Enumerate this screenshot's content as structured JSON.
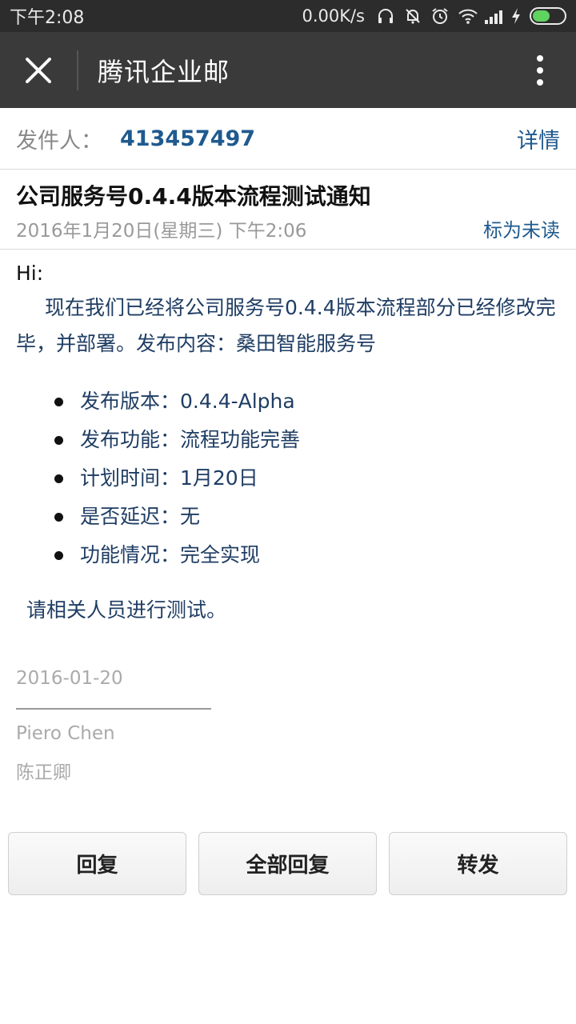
{
  "status": {
    "time": "下午2:08",
    "speed": "0.00K/s",
    "battery_level": 0.55
  },
  "appbar": {
    "title": "腾讯企业邮",
    "close_icon": "close-icon",
    "more_icon": "more-vertical-icon"
  },
  "sender": {
    "label": "发件人：",
    "address": "413457497",
    "details": "详情"
  },
  "mail": {
    "subject": "公司服务号0.4.4版本流程测试通知",
    "date": "2016年1月20日(星期三) 下午2:06",
    "mark_unread": "标为未读",
    "greeting": "Hi:",
    "paragraph": "现在我们已经将公司服务号0.4.4版本流程部分已经修改完毕，并部署。发布内容：桑田智能服务号",
    "bullets": [
      "发布版本：0.4.4-Alpha",
      "发布功能：流程功能完善",
      "计划时间：1月20日",
      "是否延迟：无",
      "功能情况：完全实现"
    ],
    "closing": "请相关人员进行测试。",
    "signature": {
      "date": "2016-01-20",
      "name": "Piero Chen",
      "name_cn": "陈正卿"
    }
  },
  "actions": {
    "reply": "回复",
    "reply_all": "全部回复",
    "forward": "转发"
  },
  "colors": {
    "accent": "#1f5a8e",
    "appbar": "#3a3a3a",
    "statusbar": "#2c2c2c"
  }
}
